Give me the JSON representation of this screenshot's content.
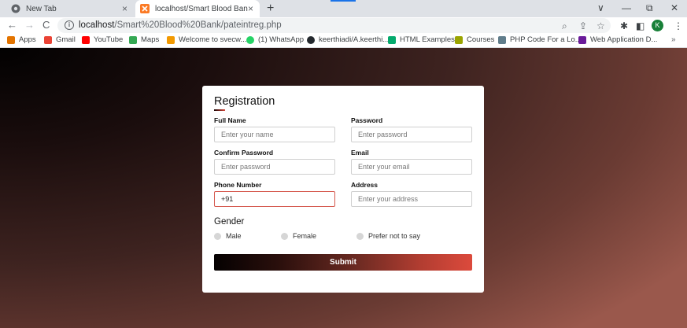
{
  "browser": {
    "tabs": [
      {
        "title": "New Tab",
        "close": "×"
      },
      {
        "title": "localhost/Smart Blood Bank/pateintreg.php",
        "close": "×"
      }
    ],
    "new_tab": "+",
    "window_controls": {
      "menu": "∨",
      "minimize": "—",
      "restore": "⧉",
      "close": "✕"
    },
    "nav": {
      "back": "←",
      "forward": "→",
      "reload": "C"
    },
    "url_host": "localhost",
    "url_path": "/Smart%20Blood%20Bank/pateintreg.php",
    "profile_initial": "K",
    "bookmarks": [
      {
        "label": "Apps",
        "color": "#e37400"
      },
      {
        "label": "Gmail",
        "color": "#ea4335"
      },
      {
        "label": "YouTube",
        "color": "#ff0000"
      },
      {
        "label": "Maps",
        "color": "#34a853"
      },
      {
        "label": "Welcome to svecw....",
        "color": "#f29900"
      },
      {
        "label": "(1) WhatsApp",
        "color": "#25d366"
      },
      {
        "label": "keerthiadi/A.keerthi...",
        "color": "#24292e"
      },
      {
        "label": "HTML Examples",
        "color": "#04aa6d"
      },
      {
        "label": "Courses",
        "color": "#9aa400"
      },
      {
        "label": "PHP Code For a Lo...",
        "color": "#607d8b"
      },
      {
        "label": "Web Application D...",
        "color": "#6a1b9a"
      }
    ],
    "bookmarks_more": "»"
  },
  "form": {
    "title": "Registration",
    "fields": {
      "full_name": {
        "label": "Full Name",
        "placeholder": "Enter your name",
        "value": ""
      },
      "password": {
        "label": "Password",
        "placeholder": "Enter password",
        "value": ""
      },
      "confirm_password": {
        "label": "Confirm Password",
        "placeholder": "Enter password",
        "value": ""
      },
      "email": {
        "label": "Email",
        "placeholder": "Enter your email",
        "value": ""
      },
      "phone": {
        "label": "Phone Number",
        "placeholder": "",
        "value": "+91"
      },
      "address": {
        "label": "Address",
        "placeholder": "Enter your address",
        "value": ""
      }
    },
    "gender": {
      "title": "Gender",
      "options": [
        "Male",
        "Female",
        "Prefer not to say"
      ]
    },
    "submit_label": "Submit"
  },
  "colors": {
    "accent": "#d9483b",
    "profile": "#188038"
  }
}
